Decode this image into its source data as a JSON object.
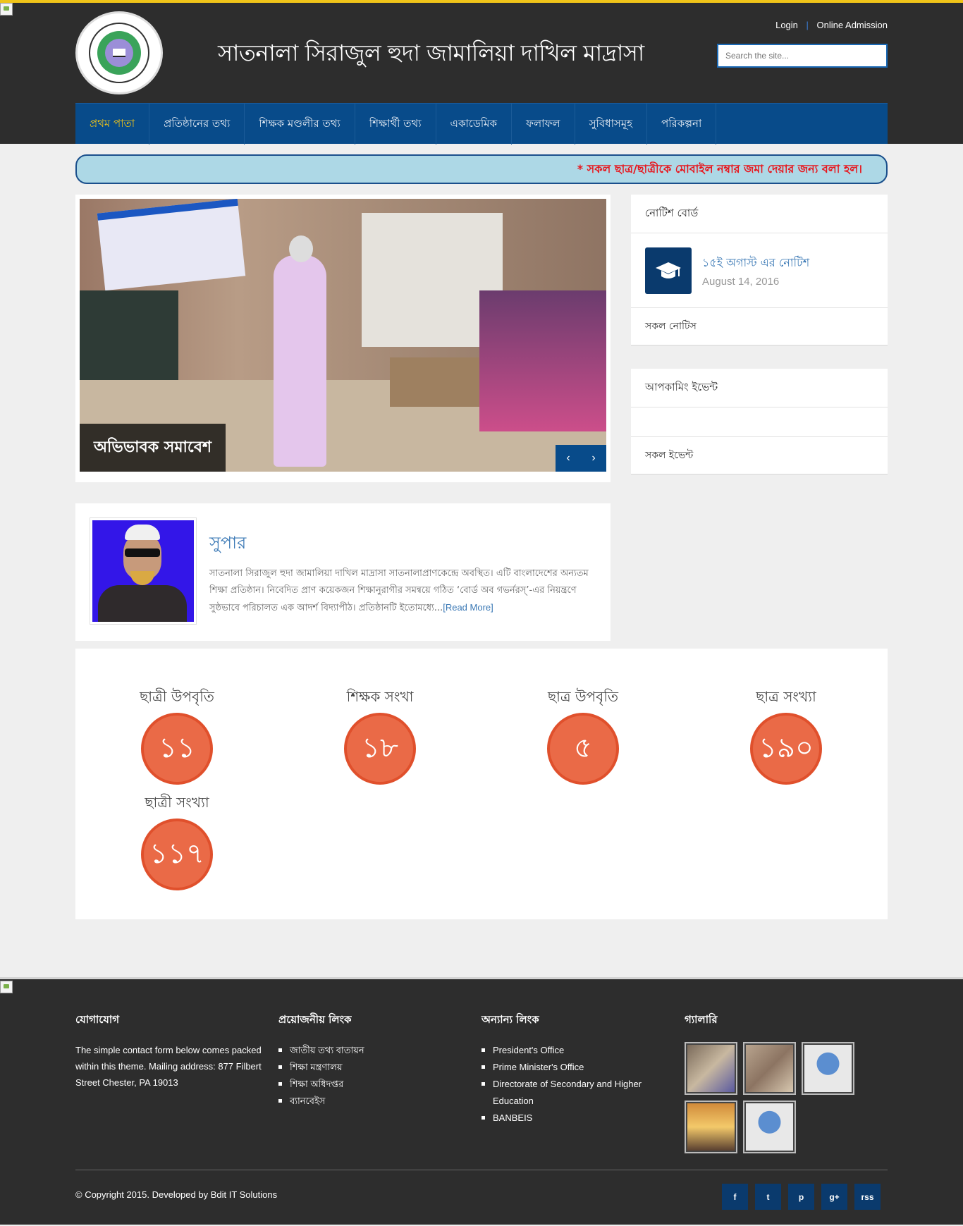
{
  "header": {
    "site_title": "সাতনালা সিরাজুল হুদা জামালিয়া দাখিল মাদ্রাসা",
    "logo_name": "madrasa-logo-seal",
    "login": "Login",
    "separator": "|",
    "online_admission": "Online Admission",
    "search_placeholder": "Search the site..."
  },
  "nav": {
    "items": [
      {
        "label": "প্রথম পাতা",
        "active": true
      },
      {
        "label": "প্রতিষ্ঠানের তথ্য"
      },
      {
        "label": "শিক্ষক মণ্ডলীর তথ্য"
      },
      {
        "label": "শিক্ষার্থী তথ্য"
      },
      {
        "label": "একাডেমিক"
      },
      {
        "label": "ফলাফল"
      },
      {
        "label": "সুবিধাসমূহ"
      },
      {
        "label": "পরিকল্পনা"
      }
    ]
  },
  "ticker": {
    "text": "* সকল ছাত্র/ছাত্রীকে মোবাইল নম্বার জমা দেয়ার জন্য বলা হল।"
  },
  "slider": {
    "caption": "অভিভাবক সমাবেশ",
    "prev_icon": "‹",
    "next_icon": "›"
  },
  "supar": {
    "title": "সুপার",
    "description": "সাতনালা সিরাজুল হুদা জামালিয়া দাখিল মাদ্রাসা সাতনালাপ্রাণকেন্দ্রে অবস্থিত। এটি বাংলাদেশের অন্যতম শিক্ষা প্রতিষ্ঠান। নিবেদিত প্রাণ কয়েকজন শিক্ষানুরাগীর সমন্বয়ে গঠিত ‘বোর্ড অব গভর্নরস্’-এর নিয়ন্ত্রণে সুষ্ঠভাবে পরিচালত এক আদর্শ বিদ্যাপীঠ। প্রতিষ্ঠানটি ইতোমধ্যে...",
    "read_more": "[Read More]"
  },
  "notice_board": {
    "title": "নোটিশ বোর্ড",
    "notices": [
      {
        "title": "১৫ই অগাস্ট এর নোটিশ",
        "date": "August 14, 2016"
      }
    ],
    "all_link": "সকল নোটিস"
  },
  "events": {
    "title": "আপকামিং ইভেন্ট",
    "all_link": "সকল ইভেন্ট"
  },
  "stats": [
    {
      "label": "ছাত্রী উপবৃতি",
      "value": "১১"
    },
    {
      "label": "শিক্ষক সংখা",
      "value": "১৮"
    },
    {
      "label": "ছাত্র উপবৃতি",
      "value": "৫"
    },
    {
      "label": "ছাত্র সংখ্যা",
      "value": "১৯০"
    },
    {
      "label": "ছাত্রী সংখ্যা",
      "value": "১১৭"
    }
  ],
  "footer": {
    "contact": {
      "title": "যোগাযোগ",
      "text": "The simple contact form below comes packed within this theme. Mailing address: 877 Filbert Street Chester, PA 19013"
    },
    "useful_links": {
      "title": "প্রয়োজনীয় লিংক",
      "items": [
        "জাতীয় তথ্য বাতায়ন",
        "শিক্ষা মন্ত্রণালয়",
        "শিক্ষা অধিদপ্তর",
        "ব্যানবেইস"
      ]
    },
    "other_links": {
      "title": "অন্যান্য লিংক",
      "items": [
        "President's Office",
        "Prime Minister's Office",
        "Directorate of Secondary and Higher Education",
        "BANBEIS"
      ]
    },
    "gallery": {
      "title": "গ্যালারি",
      "thumbs": [
        "classroom-photo",
        "meeting-photo",
        "imac-photo",
        "sunset-photo",
        "imac-photo"
      ]
    },
    "copyright": "© Copyright 2015. Developed by Bdit IT Solutions",
    "socials": [
      {
        "name": "facebook-icon",
        "glyph": "f"
      },
      {
        "name": "twitter-icon",
        "glyph": "t"
      },
      {
        "name": "pinterest-icon",
        "glyph": "p"
      },
      {
        "name": "google-plus-icon",
        "glyph": "g+"
      },
      {
        "name": "rss-icon",
        "glyph": "rss"
      }
    ]
  },
  "colors": {
    "accent_yellow": "#f0c419",
    "nav_blue": "#084b8a",
    "stat_orange": "#ea6a47",
    "ticker_bg": "#add8e6",
    "ticker_text": "#e8141b"
  }
}
